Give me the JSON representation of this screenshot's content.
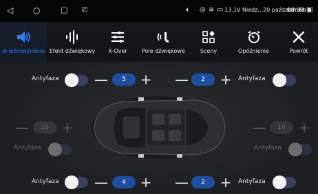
{
  "statusbar": {
    "battery_voltage": "13.1V",
    "date": "Niedz., 20 października",
    "time": "08:33"
  },
  "tabs": [
    {
      "label": "ja wzmocnienia",
      "icon": "speaker-icon",
      "active": true
    },
    {
      "label": "Efekt dźwiękowy",
      "icon": "waveform-icon",
      "active": false
    },
    {
      "label": "X-Over",
      "icon": "crossover-icon",
      "active": false
    },
    {
      "label": "Pole dźwiękowe",
      "icon": "sound-field-icon",
      "active": false
    },
    {
      "label": "Sceny",
      "icon": "scenes-icon",
      "active": false
    },
    {
      "label": "Opóźnienie",
      "icon": "timer-icon",
      "active": false
    },
    {
      "label": "Powrót",
      "icon": "close-icon",
      "active": false
    }
  ],
  "channels": {
    "front_left": {
      "antiphase_label": "Antyfaza",
      "value": "5"
    },
    "front_right": {
      "antiphase_label": "Antyfaza",
      "value": "2"
    },
    "middle_left": {
      "antiphase_label": "Antyfaza",
      "value": "10"
    },
    "middle_right": {
      "antiphase_label": "Antyfaza",
      "value": "10"
    },
    "rear_left": {
      "antiphase_label": "Antyfaza",
      "value": "4"
    },
    "rear_right": {
      "antiphase_label": "Antyfaza",
      "value": "2"
    }
  },
  "controls": {
    "minus": "—",
    "plus": "+"
  },
  "colors": {
    "accent": "#2f7ff5",
    "value_pill": "#1d4f9e",
    "toggle_track": "#3a3f5e",
    "background": "#1f2023"
  }
}
